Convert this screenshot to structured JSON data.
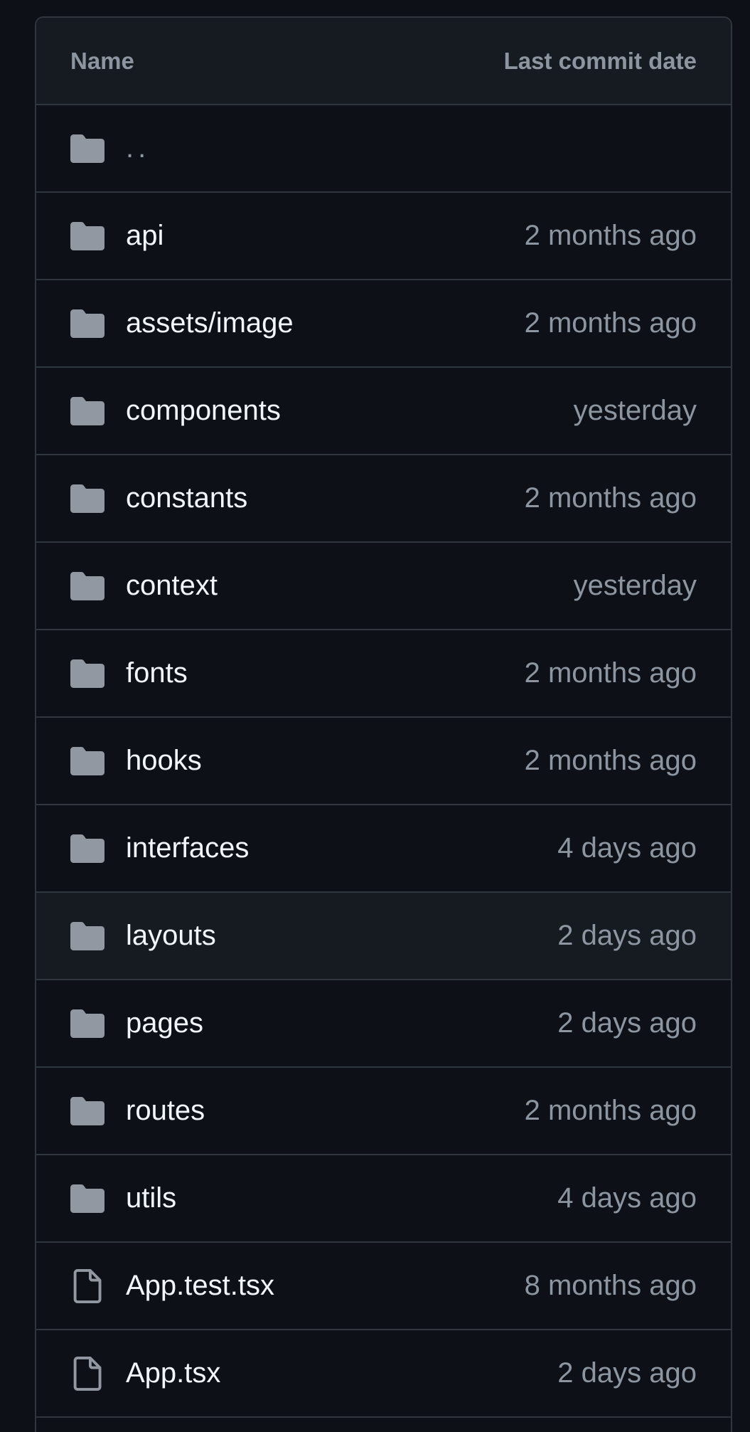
{
  "header": {
    "name_label": "Name",
    "date_label": "Last commit date"
  },
  "rows": [
    {
      "name": "..",
      "date": "",
      "type": "folder",
      "icon": "folder-icon"
    },
    {
      "name": "api",
      "date": "2 months ago",
      "type": "folder",
      "icon": "folder-icon"
    },
    {
      "name": "assets/image",
      "date": "2 months ago",
      "type": "folder",
      "icon": "folder-icon"
    },
    {
      "name": "components",
      "date": "yesterday",
      "type": "folder",
      "icon": "folder-icon"
    },
    {
      "name": "constants",
      "date": "2 months ago",
      "type": "folder",
      "icon": "folder-icon"
    },
    {
      "name": "context",
      "date": "yesterday",
      "type": "folder",
      "icon": "folder-icon"
    },
    {
      "name": "fonts",
      "date": "2 months ago",
      "type": "folder",
      "icon": "folder-icon"
    },
    {
      "name": "hooks",
      "date": "2 months ago",
      "type": "folder",
      "icon": "folder-icon"
    },
    {
      "name": "interfaces",
      "date": "4 days ago",
      "type": "folder",
      "icon": "folder-icon"
    },
    {
      "name": "layouts",
      "date": "2 days ago",
      "type": "folder",
      "icon": "folder-icon",
      "highlighted": true
    },
    {
      "name": "pages",
      "date": "2 days ago",
      "type": "folder",
      "icon": "folder-icon"
    },
    {
      "name": "routes",
      "date": "2 months ago",
      "type": "folder",
      "icon": "folder-icon"
    },
    {
      "name": "utils",
      "date": "4 days ago",
      "type": "folder",
      "icon": "folder-icon"
    },
    {
      "name": "App.test.tsx",
      "date": "8 months ago",
      "type": "file",
      "icon": "file-icon"
    },
    {
      "name": "App.tsx",
      "date": "2 days ago",
      "type": "file",
      "icon": "file-icon"
    }
  ],
  "colors": {
    "background": "#0d1117",
    "header_bg": "#161b22",
    "border": "#30363d",
    "text": "#f0f6fc",
    "muted": "#8d96a0",
    "icon": "#9198a1"
  }
}
